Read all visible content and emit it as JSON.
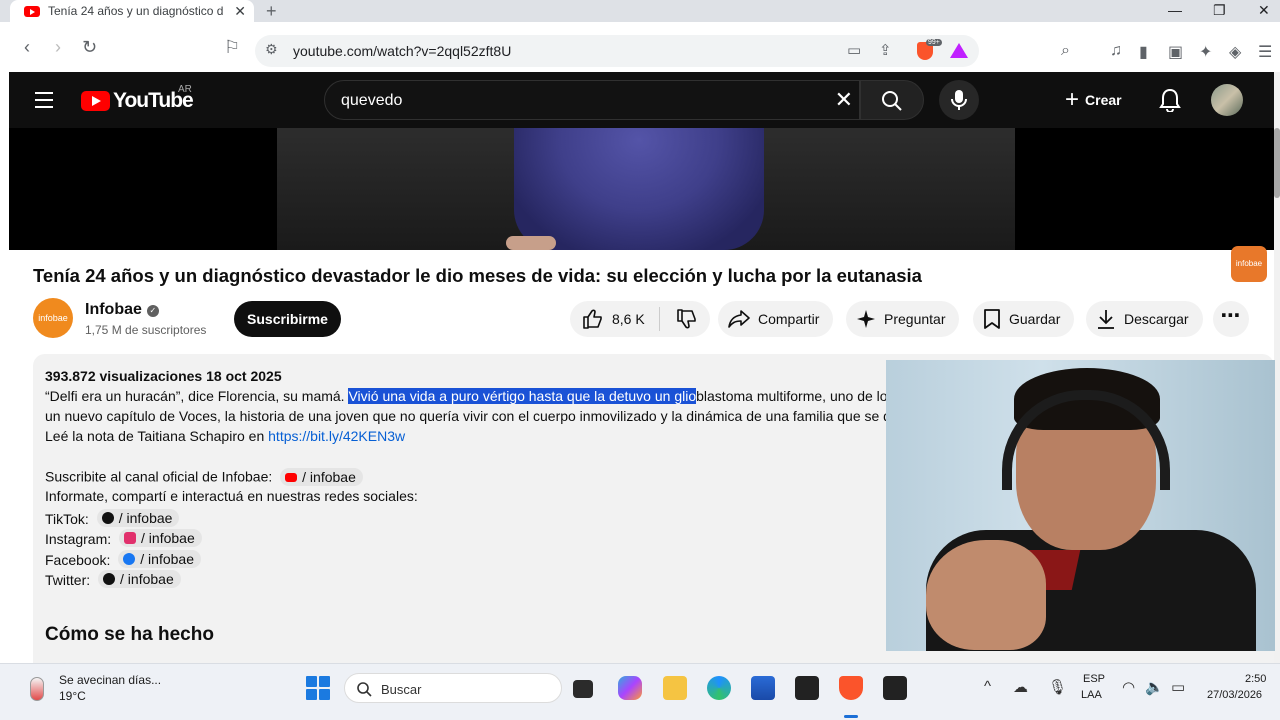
{
  "browser": {
    "tab_title": "Tenía 24 años y un diagnóstico d",
    "tab_close": "✕",
    "new_tab": "+",
    "url": "youtube.com/watch?v=2qql52zft8U",
    "brave_count": "99+"
  },
  "youtube": {
    "country": "AR",
    "logo_text": "YouTube",
    "search_query": "quevedo",
    "create_label": "Crear",
    "video_title": "Tenía 24 años y un diagnóstico devastador le dio meses de vida: su elección y lucha por la eutanasia",
    "watermark": "infobae",
    "channel": {
      "name": "Infobae",
      "subscribers": "1,75 M de suscriptores",
      "avatar_text": "infobae",
      "subscribe_label": "Suscribirme"
    },
    "actions": {
      "likes": "8,6 K",
      "share": "Compartir",
      "ask": "Preguntar",
      "save": "Guardar",
      "download": "Descargar"
    },
    "description": {
      "meta": "393.872 visualizaciones  18 oct 2025",
      "line1_pre": "“Delfi era un huracán”, dice Florencia, su mamá. ",
      "line1_selected": "Vivió una vida a puro vértigo hasta que la detuvo un glio",
      "line1_post": "blastoma multiforme, uno de los",
      "line2": "un nuevo capítulo de Voces, la historia de una joven que no quería vivir con el cuerpo inmovilizado y la dinámica de una familia que se de",
      "line3_pre": "Leé la nota de Taitiana Schapiro en ",
      "line3_link": "https://bit.ly/42KEN3w",
      "line4": "Suscribite al canal oficial de Infobae:",
      "line4_chip": "/ infobae",
      "line5": "Informate, compartí e interactuá en nuestras redes sociales:",
      "social": [
        {
          "label": "TikTok:",
          "chip": "/ infobae"
        },
        {
          "label": "Instagram:",
          "chip": "/ infobae"
        },
        {
          "label": "Facebook:",
          "chip": "/ infobae"
        },
        {
          "label": "Twitter:",
          "chip": "/ infobae"
        }
      ],
      "section_title": "Cómo se ha hecho"
    }
  },
  "taskbar": {
    "weather_text": "Se avecinan días...",
    "temperature": "19°C",
    "search_label": "Buscar",
    "lang1": "ESP",
    "lang2": "LAA",
    "time": "2:50",
    "date": "27/03/2026"
  }
}
